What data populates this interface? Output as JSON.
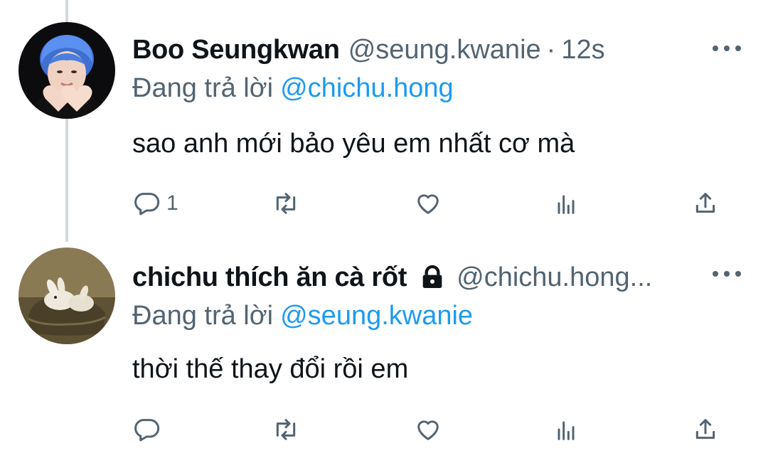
{
  "tweets": [
    {
      "display_name": "Boo Seungkwan",
      "handle": "@seung.kwanie",
      "separator": "·",
      "time": "12s",
      "replying_label": "Đang trả lời",
      "replying_to": "@chichu.hong",
      "text": "sao anh mới bảo yêu em nhất cơ mà",
      "reply_count": "1",
      "avatar": "blue-haired-person-heart-hands",
      "verified_lock": false
    },
    {
      "display_name": "chichu thích ăn cà rốt",
      "handle": "@chichu.hong",
      "handle_ellipsis": "...",
      "replying_label": "Đang trả lời",
      "replying_to": "@seung.kwanie",
      "text": "thời thế thay đổi rồi em",
      "reply_count": "",
      "avatar": "white-rabbit-figurine",
      "verified_lock": true
    }
  ],
  "icons": [
    "reply-icon",
    "retweet-icon",
    "like-icon",
    "views-icon",
    "share-icon",
    "more-icon",
    "lock-icon"
  ],
  "colors": {
    "text": "#0f1419",
    "secondary": "#536471",
    "link": "#1d9bf0",
    "thread_line": "#cfd9de"
  }
}
